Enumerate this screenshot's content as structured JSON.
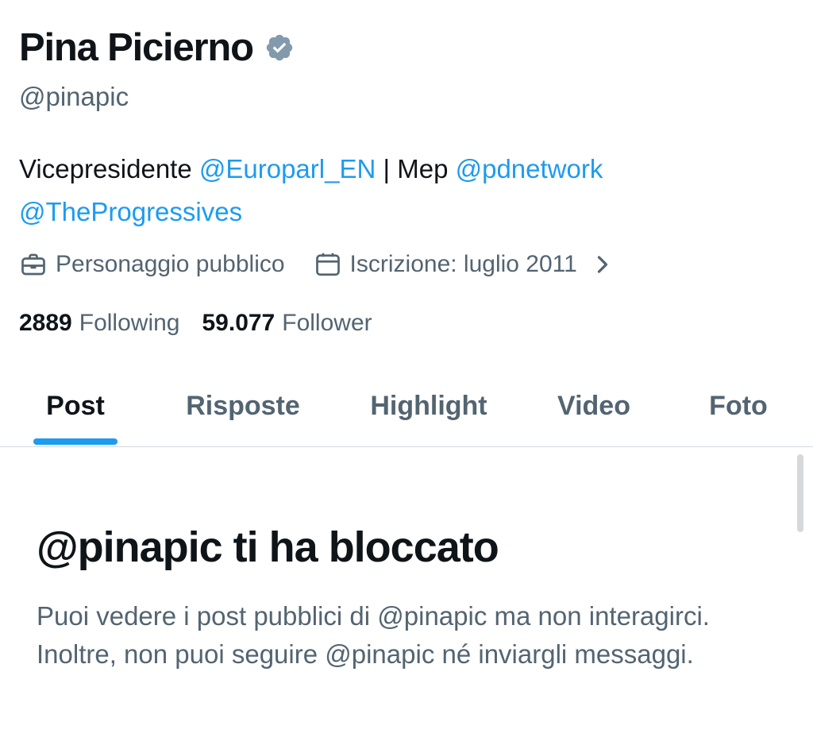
{
  "profile": {
    "display_name": "Pina Picierno",
    "verified_icon": "verified-badge-icon",
    "handle": "@pinapic",
    "bio": {
      "prefix": "Vicepresidente ",
      "mention1": "@Europarl_EN",
      "middle": " | Mep ",
      "mention2": "@pdnetwork",
      "mention3": "@TheProgressives"
    },
    "category": "Personaggio pubblico",
    "category_icon": "briefcase-icon",
    "joined": "Iscrizione: luglio 2011",
    "joined_icon": "calendar-icon",
    "stats": {
      "following_count": "2889",
      "following_label": "Following",
      "followers_count": "59.077",
      "followers_label": "Follower"
    }
  },
  "tabs": [
    {
      "label": "Post",
      "active": true
    },
    {
      "label": "Risposte",
      "active": false
    },
    {
      "label": "Highlight",
      "active": false
    },
    {
      "label": "Video",
      "active": false
    },
    {
      "label": "Foto",
      "active": false
    }
  ],
  "blocked": {
    "title": "@pinapic ti ha bloccato",
    "text": "Puoi vedere i post pubblici di @pinapic ma non interagirci. Inoltre, non puoi seguire @pinapic né inviargli messaggi."
  },
  "colors": {
    "accent": "#1d9bf0",
    "primary_text": "#0f1419",
    "secondary_text": "#536471",
    "verified_badge": "#829aab"
  }
}
